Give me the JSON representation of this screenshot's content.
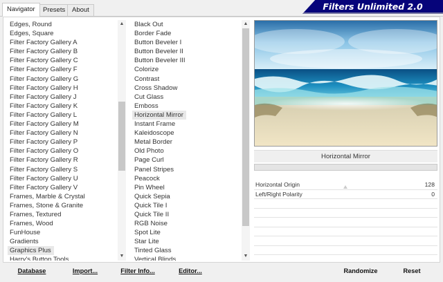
{
  "tabs": [
    {
      "label": "Navigator"
    },
    {
      "label": "Presets"
    },
    {
      "label": "About"
    }
  ],
  "brand": "Filters Unlimited 2.0",
  "categories": [
    "Edges, Round",
    "Edges, Square",
    "Filter Factory Gallery A",
    "Filter Factory Gallery B",
    "Filter Factory Gallery C",
    "Filter Factory Gallery F",
    "Filter Factory Gallery G",
    "Filter Factory Gallery H",
    "Filter Factory Gallery J",
    "Filter Factory Gallery K",
    "Filter Factory Gallery L",
    "Filter Factory Gallery M",
    "Filter Factory Gallery N",
    "Filter Factory Gallery P",
    "Filter Factory Gallery O",
    "Filter Factory Gallery R",
    "Filter Factory Gallery S",
    "Filter Factory Gallery U",
    "Filter Factory Gallery V",
    "Frames, Marble & Crystal",
    "Frames, Stone & Granite",
    "Frames, Textured",
    "Frames, Wood",
    "FunHouse",
    "Gradients",
    "Graphics Plus",
    "Harry's Button Tools"
  ],
  "selected_category": "Graphics Plus",
  "filters": [
    "Black Out",
    "Border Fade",
    "Button Beveler I",
    "Button Beveler II",
    "Button Beveler III",
    "Colorize",
    "Contrast",
    "Cross Shadow",
    "Cut Glass",
    "Emboss",
    "Horizontal Mirror",
    "Instant Frame",
    "Kaleidoscope",
    "Metal Border",
    "Old Photo",
    "Page Curl",
    "Panel Stripes",
    "Peacock",
    "Pin Wheel",
    "Quick Sepia",
    "Quick Tile I",
    "Quick Tile II",
    "RGB Noise",
    "Spot Lite",
    "Star Lite",
    "Tinted Glass",
    "Vertical Blinds"
  ],
  "selected_filter": "Horizontal Mirror",
  "preview": {
    "filter_name": "Horizontal Mirror"
  },
  "params": [
    {
      "label": "Horizontal Origin",
      "value": "128"
    },
    {
      "label": "Left/Right Polarity",
      "value": "0"
    },
    {
      "label": "",
      "value": ""
    },
    {
      "label": "",
      "value": ""
    },
    {
      "label": "",
      "value": ""
    },
    {
      "label": "",
      "value": ""
    },
    {
      "label": "",
      "value": ""
    },
    {
      "label": "",
      "value": ""
    }
  ],
  "buttons": {
    "database": "Database",
    "import": "Import...",
    "filter_info": "Filter Info...",
    "editor": "Editor...",
    "randomize": "Randomize",
    "reset": "Reset"
  },
  "colors": {
    "brand_bg": "#06047a",
    "selection": "#e8e8e8"
  }
}
